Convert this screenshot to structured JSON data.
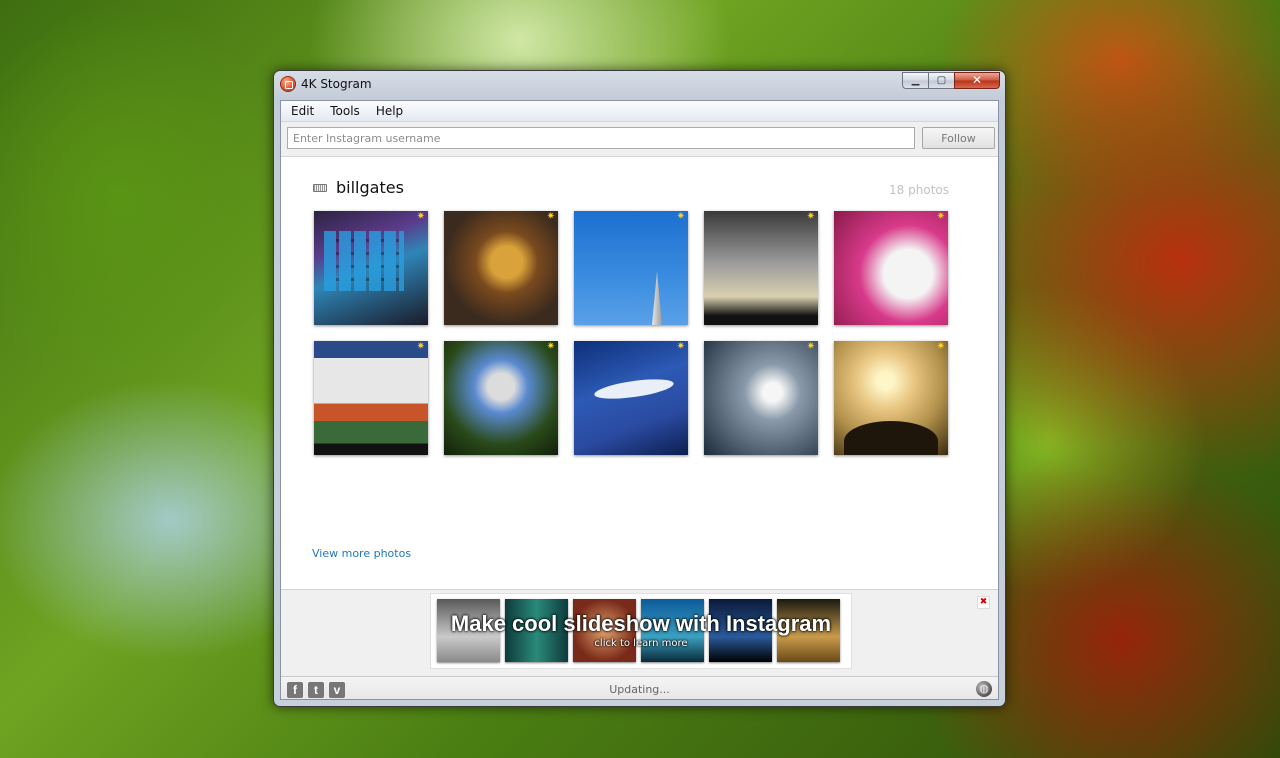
{
  "window": {
    "title": "4K Stogram",
    "min_glyph": "▁",
    "max_glyph": "▢",
    "close_glyph": "✕"
  },
  "menu": [
    "Edit",
    "Tools",
    "Help"
  ],
  "search": {
    "value": "",
    "placeholder": "Enter Instagram username",
    "follow_label": "Follow"
  },
  "profile": {
    "username": "billgates",
    "photo_count": "18 photos"
  },
  "photos": [
    {
      "description_icon": "star-icon",
      "star": "✷"
    },
    {
      "description_icon": "star-icon",
      "star": "✷"
    },
    {
      "description_icon": "star-icon",
      "star": "✷"
    },
    {
      "description_icon": "star-icon",
      "star": "✷"
    },
    {
      "description_icon": "star-icon",
      "star": "✷"
    },
    {
      "description_icon": "star-icon",
      "star": "✷"
    },
    {
      "description_icon": "star-icon",
      "star": "✷"
    },
    {
      "description_icon": "star-icon",
      "star": "✷"
    },
    {
      "description_icon": "star-icon",
      "star": "✷"
    },
    {
      "description_icon": "star-icon",
      "star": "✷"
    }
  ],
  "view_more_label": "View more photos",
  "ad": {
    "headline": "Make cool slideshow with Instagram",
    "subtext": "click to learn more",
    "close_glyph": "✖"
  },
  "status": {
    "text": "Updating...",
    "facebook_glyph": "f",
    "twitter_glyph": "t",
    "vimeo_glyph": "v",
    "globe_glyph": "◍"
  },
  "colors": {
    "accent_link": "#1f77c0",
    "star": "#ffd21a",
    "close_red": "#d00000"
  }
}
